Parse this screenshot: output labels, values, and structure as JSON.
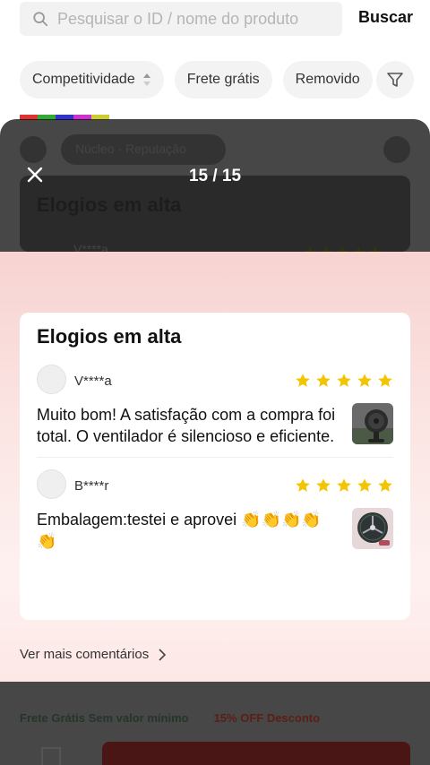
{
  "search": {
    "placeholder": "Pesquisar o ID / nome do produto",
    "button_label": "Buscar"
  },
  "filters": {
    "chips": [
      "Competitividade",
      "Frete grátis",
      "Removido"
    ]
  },
  "background_panel": {
    "tabs_label": "Núcleo · Reputação",
    "reviewer_name": "V****a"
  },
  "viewer": {
    "counter": "15 / 15",
    "ghost_title": "Elogios em alta"
  },
  "card": {
    "title": "Elogios em alta",
    "reviews": [
      {
        "user": "V****a",
        "rating": 5,
        "text": "Muito bom! A satisfação com a compra foi total. O ventilador é silencioso e eficiente."
      },
      {
        "user": "B****r",
        "rating": 5,
        "text": "Embalagem:testei e aprovei 👏👏👏👏👏"
      }
    ]
  },
  "more_link": "Ver mais comentários",
  "footer": {
    "promo_shipping": "Frete Grátis Sem valor mínimo",
    "promo_discount": "15% OFF Desconto"
  },
  "colors": {
    "star": "#f5c400",
    "feature_bg_top": "#f7d3d1",
    "overlay": "rgba(0,0,0,0.72)"
  }
}
